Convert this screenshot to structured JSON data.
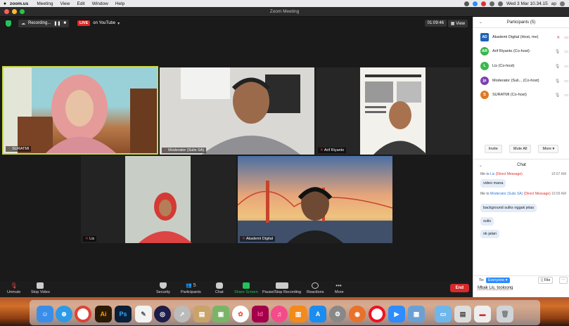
{
  "menubar": {
    "apple": "",
    "app_name": "zoom.us",
    "items": [
      "Meeting",
      "View",
      "Edit",
      "Window",
      "Help"
    ],
    "clock": "Wed 3 Mar  10.34.15",
    "user": "ap"
  },
  "window": {
    "title": "Zoom Meeting"
  },
  "status": {
    "recording": "Recording...",
    "live_badge": "LIVE",
    "live_target": "on YouTube",
    "timer": "01:09:46",
    "view_label": "View"
  },
  "tiles": [
    {
      "name": "SURATMI"
    },
    {
      "name": "Moderator (Sulis SA)"
    },
    {
      "name": "Arif Riyanto"
    },
    {
      "name": "Lis"
    },
    {
      "name": "Akademi Digital"
    }
  ],
  "toolbar": {
    "unmute": "Unmute",
    "stop_video": "Stop Video",
    "security": "Security",
    "participants": "Participants",
    "participants_count": "5",
    "chat": "Chat",
    "share": "Share Screen",
    "record": "Pause/Stop Recording",
    "reactions": "Reactions",
    "more": "More",
    "end": "End"
  },
  "participants_panel": {
    "title": "Participants (5)",
    "items": [
      {
        "initials": "AD",
        "name": "Akademi Digital (Host, me)",
        "color": "#1f63b5"
      },
      {
        "initials": "AR",
        "name": "Arif Riyanto (Co-host)",
        "color": "#39b54a"
      },
      {
        "initials": "L",
        "name": "Lis (Co-host)",
        "color": "#3cb84c"
      },
      {
        "initials": "jp",
        "name": "Moderator (Suli... (Co-host)",
        "color": "#7b3fb3"
      },
      {
        "initials": "S",
        "name": "SURATMI (Co-host)",
        "color": "#e07a1f"
      }
    ],
    "buttons": {
      "invite": "Invite",
      "mute_all": "Mute All",
      "more": "More"
    }
  },
  "chat_panel": {
    "title": "Chat",
    "messages": [
      {
        "from": "Me to ",
        "to": "Lis",
        "dm": "(Direct Message)",
        "time": "10:07 AM",
        "text": "video mana"
      },
      {
        "from": "Me to ",
        "to": "Moderator (Sulis SA)",
        "dm": "(Direct Message)",
        "time": "10:09 AM",
        "texts": [
          "background sulks nggak jelas",
          "sulis",
          "ok jalan"
        ]
      }
    ],
    "to_label": "To:",
    "recipient": "Everyone",
    "file_label": "File",
    "input_value": "Mbak Lis, tooloong"
  },
  "colors": {
    "accent": "#2d8cff",
    "live_red": "#e02828",
    "end_red": "#d6292c",
    "share_green": "#23c35b"
  }
}
